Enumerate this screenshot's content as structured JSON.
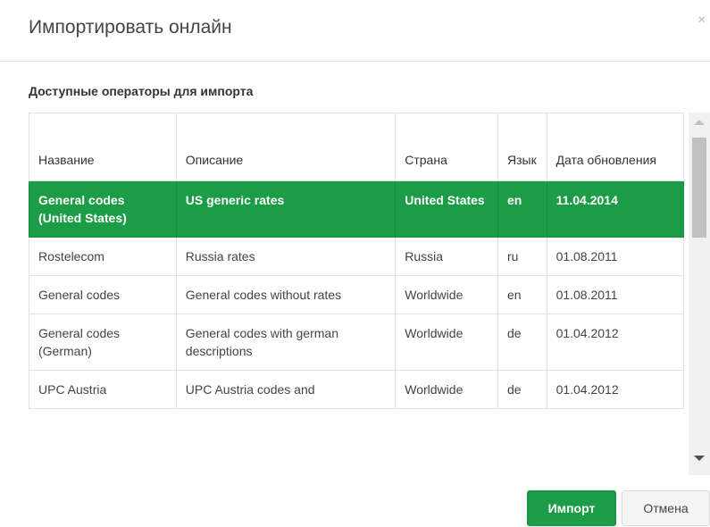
{
  "dialog": {
    "title": "Импортировать онлайн",
    "close_symbol": "×"
  },
  "section_label": "Доступные операторы для импорта",
  "table": {
    "headers": [
      "Название",
      "Описание",
      "Страна",
      "Язык",
      "Дата обновления"
    ],
    "rows": [
      {
        "name": "General codes (United States)",
        "description": "US generic rates",
        "country": "United States",
        "language": "en",
        "date": "11.04.2014",
        "selected": true
      },
      {
        "name": "Rostelecom",
        "description": "Russia rates",
        "country": "Russia",
        "language": "ru",
        "date": "01.08.2011",
        "selected": false
      },
      {
        "name": "General codes",
        "description": "General codes without rates",
        "country": "Worldwide",
        "language": "en",
        "date": "01.08.2011",
        "selected": false
      },
      {
        "name": "General codes (German)",
        "description": "General codes with german descriptions",
        "country": "Worldwide",
        "language": "de",
        "date": "01.04.2012",
        "selected": false
      },
      {
        "name": "UPC Austria",
        "description": "UPC Austria codes and",
        "country": "Worldwide",
        "language": "de",
        "date": "01.04.2012",
        "selected": false
      }
    ]
  },
  "buttons": {
    "import_label": "Импорт",
    "cancel_label": "Отмена"
  },
  "colors": {
    "accent": "#1c9c46"
  }
}
